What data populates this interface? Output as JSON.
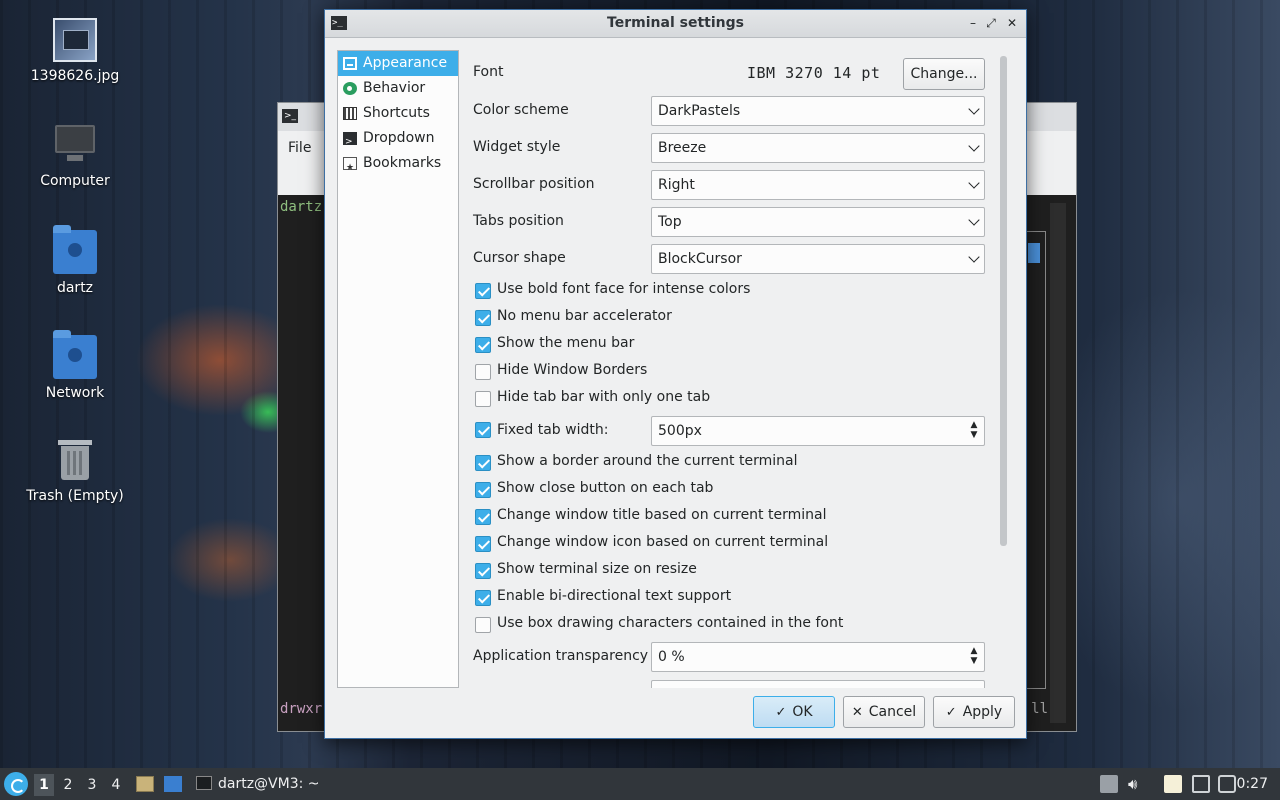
{
  "desktop": {
    "icons": [
      {
        "label": "1398626.jpg"
      },
      {
        "label": "Computer"
      },
      {
        "label": "dartz"
      },
      {
        "label": "Network"
      },
      {
        "label": "Trash (Empty)"
      }
    ]
  },
  "background_window": {
    "menu_file": "File",
    "prompt_top": "dartz",
    "prompt_bottom": "drwxr",
    "text_right": "ll"
  },
  "dialog": {
    "title": "Terminal settings",
    "window_buttons": {
      "minimize": "–",
      "maximize": "⤢",
      "close": "✕"
    },
    "sidebar": [
      {
        "label": "Appearance",
        "icon": "appearance-icon",
        "active": true
      },
      {
        "label": "Behavior",
        "icon": "behavior-icon",
        "active": false
      },
      {
        "label": "Shortcuts",
        "icon": "keyboard-icon",
        "active": false
      },
      {
        "label": "Dropdown",
        "icon": "terminal-icon",
        "active": false
      },
      {
        "label": "Bookmarks",
        "icon": "bookmark-icon",
        "active": false
      }
    ],
    "font": {
      "label": "Font",
      "value": "IBM 3270 14 pt",
      "button": "Change..."
    },
    "selects": [
      {
        "label": "Color scheme",
        "value": "DarkPastels"
      },
      {
        "label": "Widget style",
        "value": "Breeze"
      },
      {
        "label": "Scrollbar position",
        "value": "Right"
      },
      {
        "label": "Tabs position",
        "value": "Top"
      },
      {
        "label": "Cursor shape",
        "value": "BlockCursor"
      }
    ],
    "checks_a": [
      {
        "label": "Use bold font face for intense colors",
        "checked": true
      },
      {
        "label": "No menu bar accelerator",
        "checked": true
      },
      {
        "label": "Show the menu bar",
        "checked": true
      },
      {
        "label": "Hide Window Borders",
        "checked": false
      },
      {
        "label": "Hide tab bar with only one tab",
        "checked": false
      }
    ],
    "fixed_tab": {
      "label": "Fixed tab width:",
      "checked": true,
      "value": "500px"
    },
    "checks_b": [
      {
        "label": "Show a border around the current terminal",
        "checked": true
      },
      {
        "label": "Show close button on each tab",
        "checked": true
      },
      {
        "label": "Change window title based on current terminal",
        "checked": true
      },
      {
        "label": "Change window icon based on current terminal",
        "checked": true
      },
      {
        "label": "Show terminal size on resize",
        "checked": true
      },
      {
        "label": "Enable bi-directional text support",
        "checked": true
      },
      {
        "label": "Use box drawing characters contained in the font",
        "checked": false
      }
    ],
    "transparency": {
      "label": "Application transparency",
      "value": "0 %"
    },
    "buttons": {
      "ok": "OK",
      "cancel": "Cancel",
      "apply": "Apply"
    },
    "spin_arrows": "⌃⌄"
  },
  "taskbar": {
    "workspaces": [
      "1",
      "2",
      "3",
      "4"
    ],
    "active_workspace": "1",
    "task_label": "dartz@VM3: ~",
    "clock": "0:27"
  },
  "colors": {
    "accent": "#3daee9",
    "window_bg": "#eff0f1",
    "taskbar_bg": "#31363b"
  }
}
